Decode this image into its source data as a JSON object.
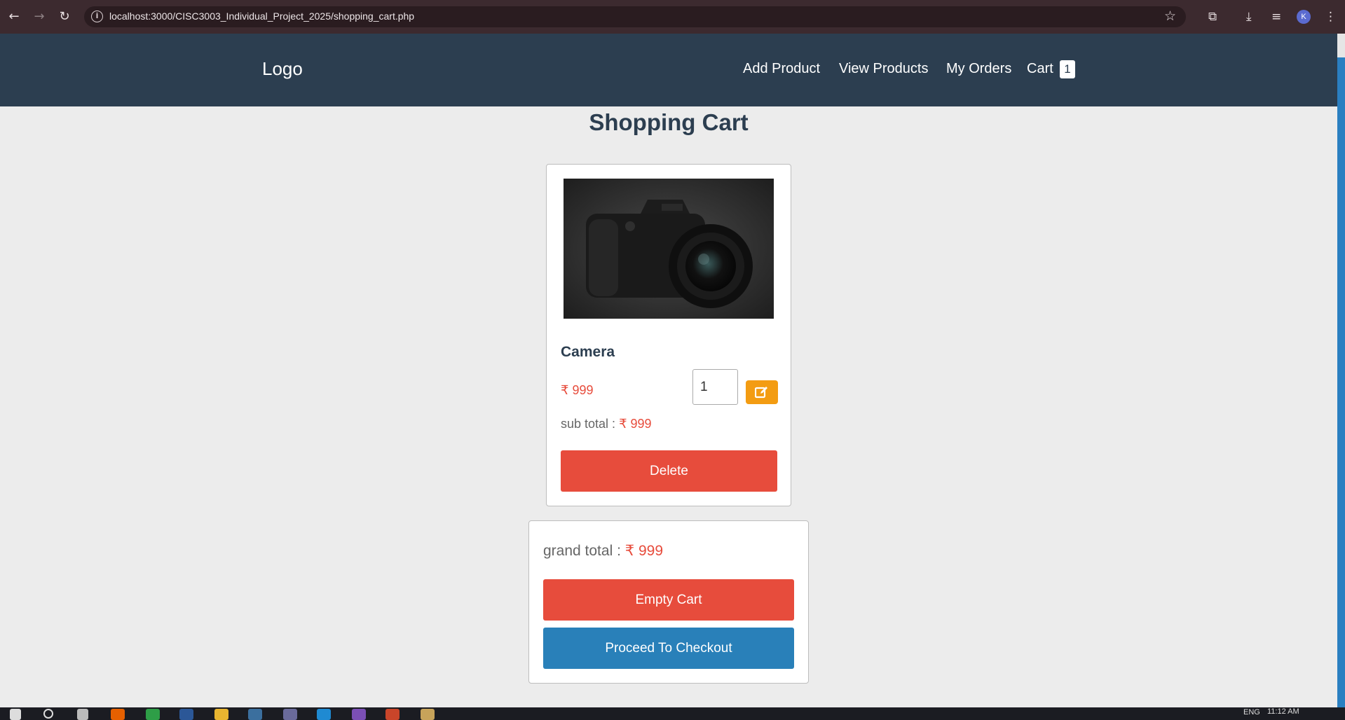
{
  "browser": {
    "url": "localhost:3000/CISC3003_Individual_Project_2025/shopping_cart.php",
    "avatar_initial": "K"
  },
  "header": {
    "logo": "Logo",
    "nav": [
      "Add Product",
      "View Products",
      "My Orders",
      "Cart"
    ],
    "cart_count": "1"
  },
  "page": {
    "title": "Shopping Cart"
  },
  "cart_item": {
    "name": "Camera",
    "currency_symbol": "₹",
    "price": "999",
    "quantity": "1",
    "subtotal_label": "sub total :",
    "subtotal": "999",
    "delete_label": "Delete"
  },
  "totals": {
    "grand_label": "grand total :",
    "grand_total": "999",
    "empty_label": "Empty Cart",
    "checkout_label": "Proceed To Checkout"
  },
  "taskbar": {
    "lang": "ENG",
    "time": "11:12 AM"
  },
  "colors": {
    "header_bg": "#2c3e50",
    "danger": "#e74c3c",
    "primary": "#2980b9",
    "warning": "#f39c12"
  }
}
